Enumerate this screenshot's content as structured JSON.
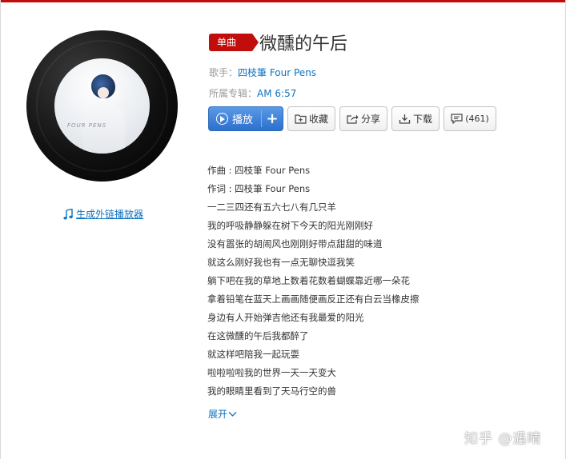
{
  "album": {
    "cover_text": "FOUR PENS"
  },
  "external_player_link": "生成外链播放器",
  "song": {
    "badge": "单曲",
    "title": "微醺的午后",
    "singer_label": "歌手：",
    "singer": "四枝筆 Four Pens",
    "album_label": "所属专辑：",
    "album": "AM 6:57"
  },
  "buttons": {
    "play": "播放",
    "add": "+",
    "favorite": "收藏",
    "share": "分享",
    "download": "下载",
    "comments": "(461)"
  },
  "lyrics": [
    "作曲 : 四枝筆 Four Pens",
    "作词 : 四枝筆 Four Pens",
    "一二三四还有五六七八有几只羊",
    "我的呼吸静静躲在树下今天的阳光刚刚好",
    "没有嚣张的胡闹风也刚刚好带点甜甜的味道",
    "就这么刚好我也有一点无聊快逗我笑",
    "躺下吧在我的草地上数着花数着蝴蝶靠近哪一朵花",
    "拿着铅笔在蓝天上画画随便画反正还有白云当橡皮擦",
    "身边有人开始弹吉他还有我最爱的阳光",
    "在这微醺的午后我都醉了",
    "就这样吧陪我一起玩耍",
    "啦啦啦啦我的世界一天一天变大",
    "我的眼睛里看到了天马行空的兽"
  ],
  "expand_label": "展开",
  "watermark": "知乎 @遇晴",
  "colors": {
    "accent_red": "#c10d0c",
    "link_blue": "#0c73c2",
    "play_blue": "#2c6fcd"
  }
}
